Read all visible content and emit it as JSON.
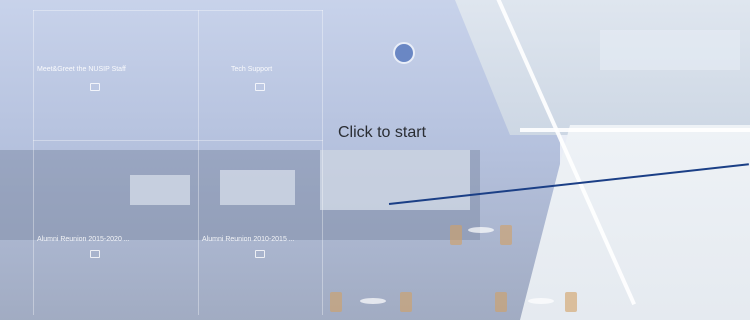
{
  "start_prompt": "Click to start",
  "booths": [
    {
      "label": "Meet&Greet the NUSIP Staff",
      "icon": "calendar-icon"
    },
    {
      "label": "Tech Support",
      "icon": "calendar-icon"
    },
    {
      "label": "Alumni Reunion 2015-2020 ...",
      "icon": "calendar-icon"
    },
    {
      "label": "Alumni Reunion 2010-2015 ...",
      "icon": "calendar-icon"
    }
  ],
  "colors": {
    "pointer": "#1b3f86"
  }
}
